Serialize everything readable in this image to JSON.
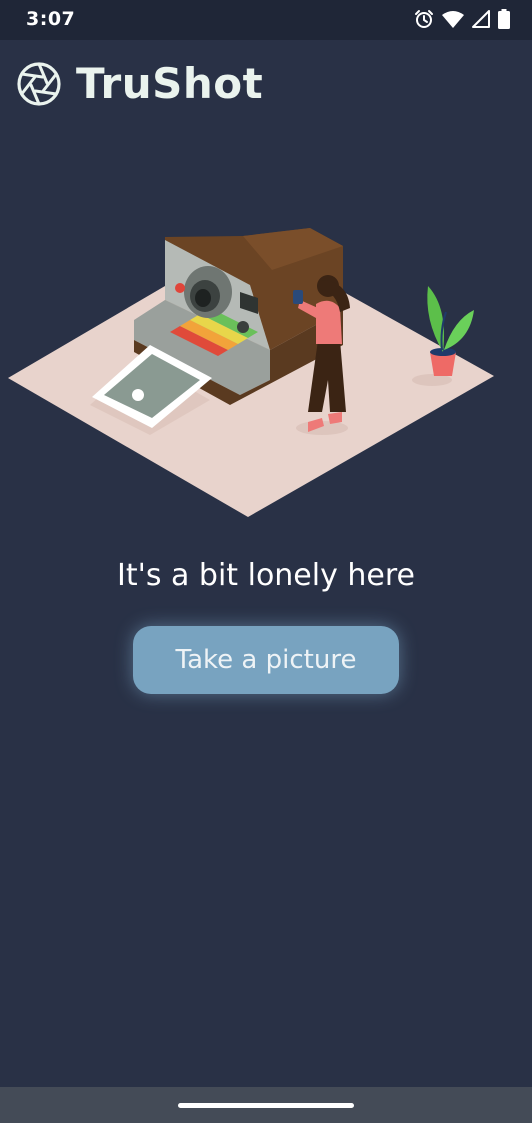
{
  "status_bar": {
    "time": "3:07",
    "icons": [
      "alarm-icon",
      "wifi-icon",
      "signal-icon",
      "battery-icon"
    ]
  },
  "app_bar": {
    "title": "TruShot",
    "logo_icon": "aperture-icon"
  },
  "empty_state": {
    "message": "It's a bit lonely here",
    "button_label": "Take a picture"
  },
  "colors": {
    "background": "#293146",
    "button": "#78a3c0",
    "title": "#eaf3ee"
  }
}
